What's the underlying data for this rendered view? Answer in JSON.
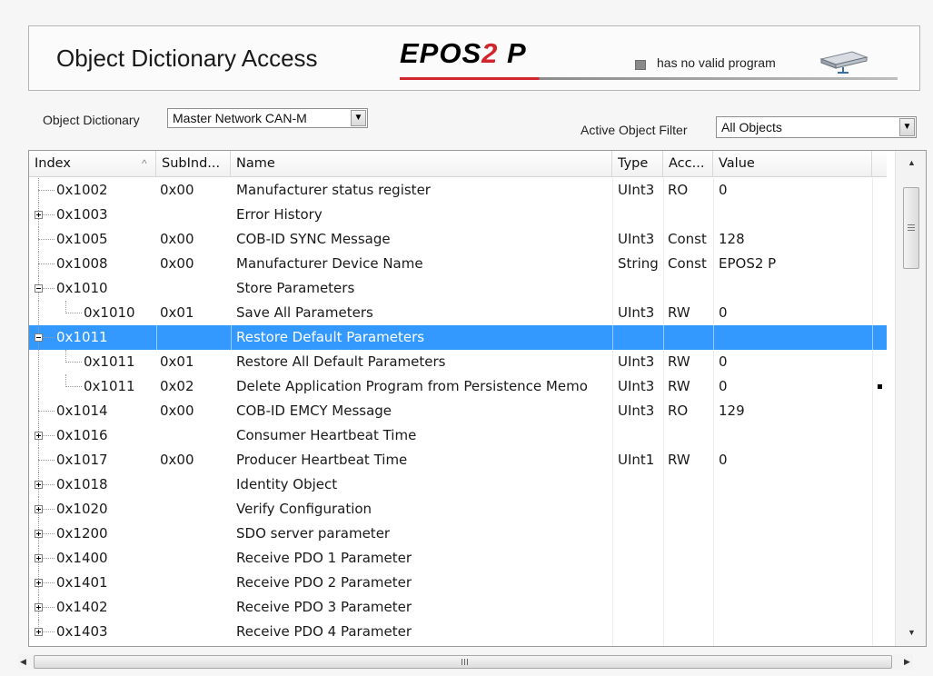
{
  "header": {
    "title": "Object Dictionary Access",
    "logo_text": "EPOS",
    "logo_num": "2",
    "logo_suffix": " P",
    "status_text": "has no valid program",
    "device_icon": "device-icon"
  },
  "controls": {
    "object_dictionary_label": "Object Dictionary",
    "object_dictionary_value": "Master Network CAN-M",
    "filter_label": "Active Object Filter",
    "filter_value": "All Objects"
  },
  "table": {
    "columns": [
      "Index",
      "SubInd...",
      "Name",
      "Type",
      "Acc...",
      "Value"
    ],
    "rows": [
      {
        "index": "0x1002",
        "sub": "0x00",
        "name": "Manufacturer status register",
        "type": "UInt3",
        "access": "RO",
        "value": "0",
        "level": 0,
        "expander": ""
      },
      {
        "index": "0x1003",
        "sub": "",
        "name": "Error History",
        "type": "",
        "access": "",
        "value": "",
        "level": 0,
        "expander": "plus"
      },
      {
        "index": "0x1005",
        "sub": "0x00",
        "name": "COB-ID SYNC Message",
        "type": "UInt3",
        "access": "Const",
        "value": "128",
        "level": 0,
        "expander": ""
      },
      {
        "index": "0x1008",
        "sub": "0x00",
        "name": "Manufacturer Device Name",
        "type": "String",
        "access": "Const",
        "value": "EPOS2 P",
        "level": 0,
        "expander": ""
      },
      {
        "index": "0x1010",
        "sub": "",
        "name": "Store Parameters",
        "type": "",
        "access": "",
        "value": "",
        "level": 0,
        "expander": "minus"
      },
      {
        "index": "0x1010",
        "sub": "0x01",
        "name": "Save All Parameters",
        "type": "UInt3",
        "access": "RW",
        "value": "0",
        "level": 1,
        "expander": ""
      },
      {
        "index": "0x1011",
        "sub": "",
        "name": "Restore Default Parameters",
        "type": "",
        "access": "",
        "value": "",
        "level": 0,
        "expander": "minus",
        "selected": true
      },
      {
        "index": "0x1011",
        "sub": "0x01",
        "name": "Restore All Default Parameters",
        "type": "UInt3",
        "access": "RW",
        "value": "0",
        "level": 1,
        "expander": ""
      },
      {
        "index": "0x1011",
        "sub": "0x02",
        "name": "Delete Application Program from Persistence Memo",
        "type": "UInt3",
        "access": "RW",
        "value": "0",
        "level": 1,
        "expander": ""
      },
      {
        "index": "0x1014",
        "sub": "0x00",
        "name": "COB-ID EMCY Message",
        "type": "UInt3",
        "access": "RO",
        "value": "129",
        "level": 0,
        "expander": ""
      },
      {
        "index": "0x1016",
        "sub": "",
        "name": "Consumer Heartbeat Time",
        "type": "",
        "access": "",
        "value": "",
        "level": 0,
        "expander": "plus"
      },
      {
        "index": "0x1017",
        "sub": "0x00",
        "name": "Producer Heartbeat Time",
        "type": "UInt1",
        "access": "RW",
        "value": "0",
        "level": 0,
        "expander": ""
      },
      {
        "index": "0x1018",
        "sub": "",
        "name": "Identity Object",
        "type": "",
        "access": "",
        "value": "",
        "level": 0,
        "expander": "plus"
      },
      {
        "index": "0x1020",
        "sub": "",
        "name": "Verify Configuration",
        "type": "",
        "access": "",
        "value": "",
        "level": 0,
        "expander": "plus"
      },
      {
        "index": "0x1200",
        "sub": "",
        "name": "SDO server parameter",
        "type": "",
        "access": "",
        "value": "",
        "level": 0,
        "expander": "plus"
      },
      {
        "index": "0x1400",
        "sub": "",
        "name": "Receive PDO 1 Parameter",
        "type": "",
        "access": "",
        "value": "",
        "level": 0,
        "expander": "plus"
      },
      {
        "index": "0x1401",
        "sub": "",
        "name": "Receive PDO 2 Parameter",
        "type": "",
        "access": "",
        "value": "",
        "level": 0,
        "expander": "plus"
      },
      {
        "index": "0x1402",
        "sub": "",
        "name": "Receive PDO 3 Parameter",
        "type": "",
        "access": "",
        "value": "",
        "level": 0,
        "expander": "plus"
      },
      {
        "index": "0x1403",
        "sub": "",
        "name": "Receive PDO 4 Parameter",
        "type": "",
        "access": "",
        "value": "",
        "level": 0,
        "expander": "plus"
      }
    ]
  },
  "scrollbar": {
    "hgrip_label": "III",
    "vgrip_label": "≡"
  },
  "colors": {
    "selection": "#3399ff",
    "logo_red": "#d1262d"
  }
}
